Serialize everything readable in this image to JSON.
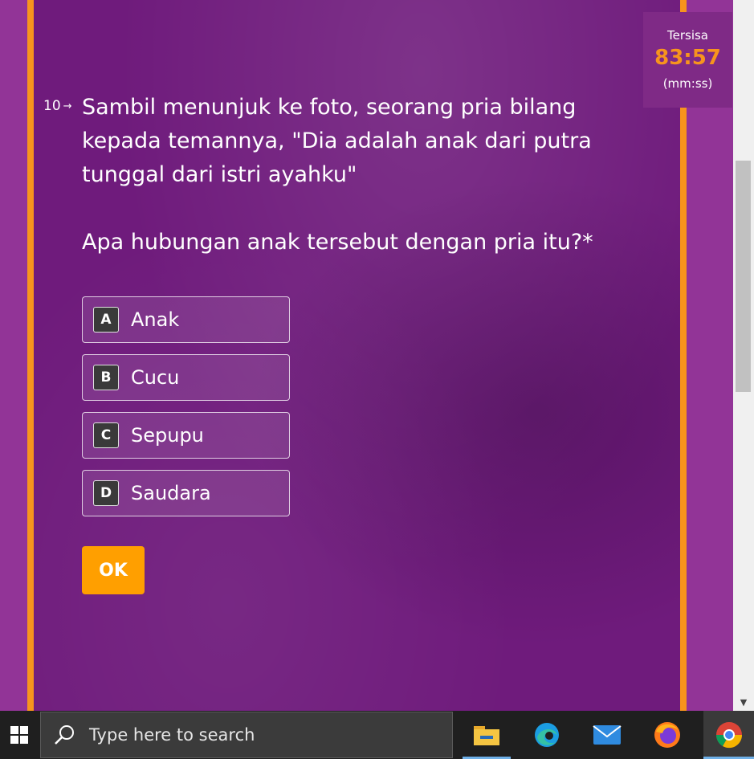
{
  "timer": {
    "label": "Tersisa",
    "value": "83:57",
    "unit": "(mm:ss)"
  },
  "question": {
    "number": "10",
    "arrow": "→",
    "text": "Sambil menunjuk ke foto, seorang pria bilang kepada temannya, \"Dia adalah anak dari putra tunggal dari istri ayahku\"",
    "prompt": "Apa hubungan anak tersebut dengan pria itu?*"
  },
  "options": [
    {
      "key": "A",
      "label": "Anak"
    },
    {
      "key": "B",
      "label": "Cucu"
    },
    {
      "key": "C",
      "label": "Sepupu"
    },
    {
      "key": "D",
      "label": "Saudara"
    }
  ],
  "ok_label": "OK",
  "taskbar": {
    "search_placeholder": "Type here to search",
    "apps": [
      "file-explorer-icon",
      "edge-icon",
      "mail-icon",
      "firefox-icon",
      "chrome-icon"
    ]
  },
  "colors": {
    "accent": "#f7941d",
    "panel": "#6f1b7c",
    "ok_button": "#ff9f00"
  }
}
